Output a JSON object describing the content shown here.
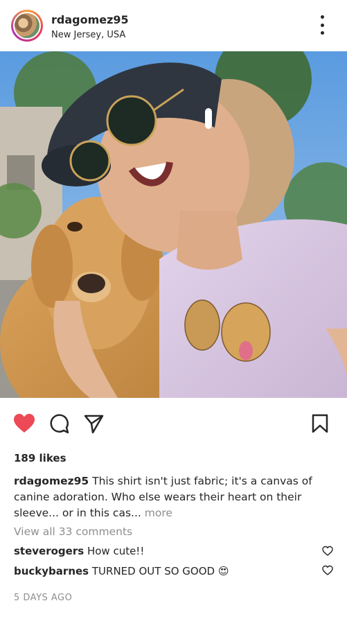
{
  "post": {
    "username": "rdagomez95",
    "location": "New Jersey, USA",
    "likes": "189 likes",
    "caption_username": "rdagomez95",
    "caption_text": "This shirt isn't just fabric; it's a canvas of canine adoration. Who else wears their heart on their sleeve... or in this cas...",
    "caption_more": "more",
    "view_all_comments": "View all 33 comments",
    "comments": [
      {
        "username": "steverogers",
        "text": "How cute!!"
      },
      {
        "username": "buckybarnes",
        "text": "TURNED OUT SO GOOD",
        "emoji": "😍"
      }
    ],
    "time_ago": "5 DAYS AGO"
  },
  "icons": {
    "like": "heart-icon",
    "comment": "comment-icon",
    "share": "send-icon",
    "save": "bookmark-icon",
    "more": "more-vertical-icon"
  },
  "colors": {
    "like_red": "#ed4956",
    "text": "#262626",
    "muted": "#8e8e8e"
  }
}
